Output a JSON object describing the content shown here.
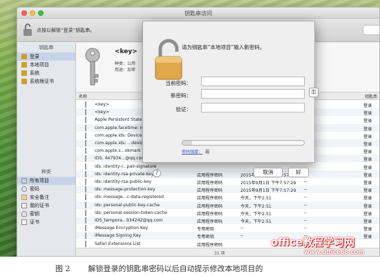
{
  "window": {
    "title": "钥匙串访问"
  },
  "toolbar": {
    "unlock_hint": "点按以解锁“登录”钥匙串。"
  },
  "sidebar": {
    "keychains_header": "钥匙串",
    "keychains": [
      {
        "label": "登录",
        "icon": "lock-icon",
        "selected": true
      },
      {
        "label": "本地项目",
        "icon": "lock-icon",
        "selected": false
      },
      {
        "label": "系统",
        "icon": "lock-icon",
        "selected": false
      },
      {
        "label": "系统根证书",
        "icon": "lock-icon",
        "selected": false
      }
    ],
    "categories_header": "种类",
    "categories": [
      {
        "label": "所有项目",
        "icon": "keys-icon",
        "selected": true
      },
      {
        "label": "密码",
        "icon": "password-icon",
        "selected": false
      },
      {
        "label": "安全备注",
        "icon": "note-icon",
        "selected": false
      },
      {
        "label": "我的证书",
        "icon": "certificate-icon",
        "selected": false
      },
      {
        "label": "密钥",
        "icon": "key-icon",
        "selected": false
      },
      {
        "label": "证书",
        "icon": "certificate-icon",
        "selected": false
      }
    ]
  },
  "info_panel": {
    "name": "<key>",
    "kind_label": "种类：",
    "kind_value": "公用",
    "usage_label": "用途：",
    "usage_value": "加密"
  },
  "table": {
    "headers": {
      "name": "名称",
      "keychain": "钥匙串"
    },
    "rows": [
      {
        "name": "<key>",
        "kind": "",
        "date": "",
        "expires": "",
        "keychain": "登录"
      },
      {
        "name": "<key>",
        "kind": "",
        "date": "",
        "expires": "",
        "keychain": "登录"
      },
      {
        "name": "Apple Persistent State",
        "kind": "",
        "date": "",
        "expires": "",
        "keychain": "登录"
      },
      {
        "name": "com.apple.facetime: re",
        "kind": "",
        "date": "",
        "expires": "",
        "keychain": "登录"
      },
      {
        "name": "com.apple.ids: Device",
        "kind": "",
        "date": "",
        "expires": "",
        "keychain": "登录"
      },
      {
        "name": "com.apple.ids: ...device",
        "kind": "",
        "date": "",
        "expires": "",
        "keychain": "登录"
      },
      {
        "name": "com.apple.s...okmark",
        "kind": "",
        "date": "",
        "expires": "",
        "keychain": "登录"
      },
      {
        "name": "IDS: 447934...@qq.com",
        "kind": "",
        "date": "",
        "expires": "",
        "keychain": "登录"
      },
      {
        "name": "ids: identity-r...pair-signature",
        "kind": "",
        "date": "",
        "expires": "",
        "keychain": "登录"
      },
      {
        "name": "ids: identity-rsa-private-key",
        "kind": "应用程序密码",
        "date": "2015年9月1日 下午7:57:29",
        "expires": "--",
        "keychain": "登录"
      },
      {
        "name": "ids: identity-rsa-public-key",
        "kind": "应用程序密码",
        "date": "2015年9月1日 下午7:57:29",
        "expires": "--",
        "keychain": "登录"
      },
      {
        "name": "ids: message-protection-key",
        "kind": "应用程序密码",
        "date": "2015年9月1日 下午7:57:29",
        "expires": "--",
        "keychain": "登录"
      },
      {
        "name": "ids: message...c-data-registered",
        "kind": "应用程序密码",
        "date": "今天，下午2:51",
        "expires": "--",
        "keychain": "登录"
      },
      {
        "name": "ids: personal-public-key-cache",
        "kind": "应用程序密码",
        "date": "今天，下午2:51",
        "expires": "--",
        "keychain": "登录"
      },
      {
        "name": "ids: personal-session-token-cache",
        "kind": "应用程序密码",
        "date": "今天，下午2:51",
        "expires": "--",
        "keychain": "登录"
      },
      {
        "name": "IDS_tempora...934242@qq.com",
        "kind": "应用程序密码",
        "date": "今天，下午2:51",
        "expires": "--",
        "keychain": "登录"
      },
      {
        "name": "iMessage Encryption Key",
        "kind": "专用密钥",
        "date": "--",
        "expires": "--",
        "keychain": "登录"
      },
      {
        "name": "iMessage Signing Key",
        "kind": "专用密钥",
        "date": "--",
        "expires": "--",
        "keychain": "登录"
      },
      {
        "name": "Safari Extensions List",
        "kind": "应用程序密码",
        "date": "",
        "expires": "",
        "keychain": ""
      }
    ],
    "count": "31 项"
  },
  "dialog": {
    "prompt": "请为钥匙串“本地项目”输入新密码。",
    "current_label": "当前密码：",
    "new_label": "新密码：",
    "verify_label": "验证：",
    "strength_label": "密码强度：",
    "strength_value": "弱",
    "strength_fraction": 0.08,
    "cancel": "取消",
    "ok": "好",
    "help": "?",
    "key_button": "key-icon"
  },
  "caption": {
    "number": "图 2",
    "text": "解锁登录的钥匙串密码以后自动提示修改本地项目的"
  },
  "watermark": {
    "brand": "office教程学习网",
    "url": "www.office68.com"
  }
}
